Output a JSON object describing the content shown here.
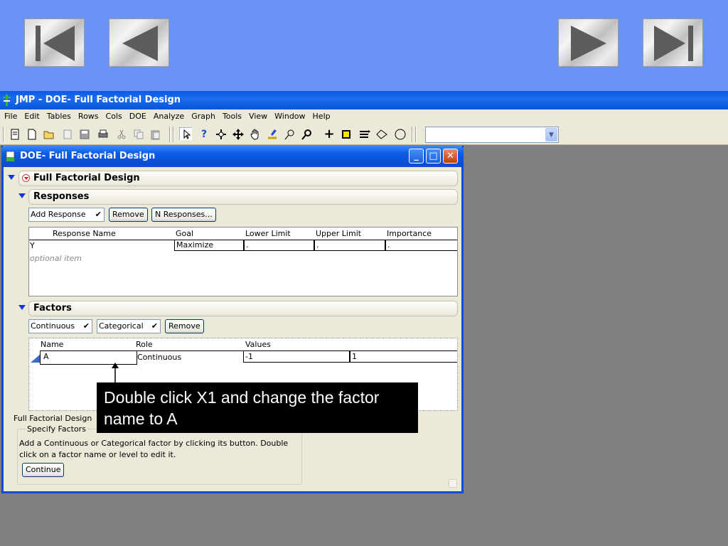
{
  "nav_buttons": [
    {
      "name": "first-slide",
      "icon": "skip-back-icon"
    },
    {
      "name": "previous-slide",
      "icon": "back-icon"
    },
    {
      "name": "next-slide",
      "icon": "play-forward-icon"
    },
    {
      "name": "last-slide",
      "icon": "skip-forward-icon"
    }
  ],
  "app": {
    "title": "JMP - DOE- Full Factorial Design",
    "menu": [
      "File",
      "Edit",
      "Tables",
      "Rows",
      "Cols",
      "DOE",
      "Analyze",
      "Graph",
      "Tools",
      "View",
      "Window",
      "Help"
    ],
    "toolbar_select_value": ""
  },
  "doe_window": {
    "title": "DOE- Full Factorial Design",
    "controls": {
      "minimize": "_",
      "maximize": "□",
      "close": "✕"
    },
    "root_outline": "Full Factorial Design",
    "responses": {
      "heading": "Responses",
      "add_response_label": "Add Response",
      "remove_label": "Remove",
      "n_responses_label": "N Responses...",
      "columns": [
        "Response Name",
        "Goal",
        "Lower Limit",
        "Upper Limit",
        "Importance"
      ],
      "rows": [
        {
          "name": "Y",
          "goal": "Maximize",
          "lower": ".",
          "upper": ".",
          "importance": "."
        }
      ],
      "optional_item": "optional item"
    },
    "factors": {
      "heading": "Factors",
      "continuous_label": "Continuous",
      "categorical_label": "Categorical",
      "remove_label": "Remove",
      "columns": [
        "Name",
        "Role",
        "Values"
      ],
      "rows": [
        {
          "name": "A",
          "role": "Continuous",
          "value_low": "-1",
          "value_high": "1"
        }
      ]
    },
    "status_label": "Full Factorial Design",
    "specify": {
      "legend": "Specify Factors",
      "text": "Add a Continuous or Categorical factor by clicking its button. Double click on a factor name or level to edit it.",
      "continue_label": "Continue"
    }
  },
  "callout": {
    "text": "Double click X1 and change the factor name to A"
  },
  "colors": {
    "slide_background": "#6a93fa",
    "xp_blue": "#0a4fd6",
    "xp_face": "#ece9d8",
    "workspace_gray": "#808080"
  }
}
